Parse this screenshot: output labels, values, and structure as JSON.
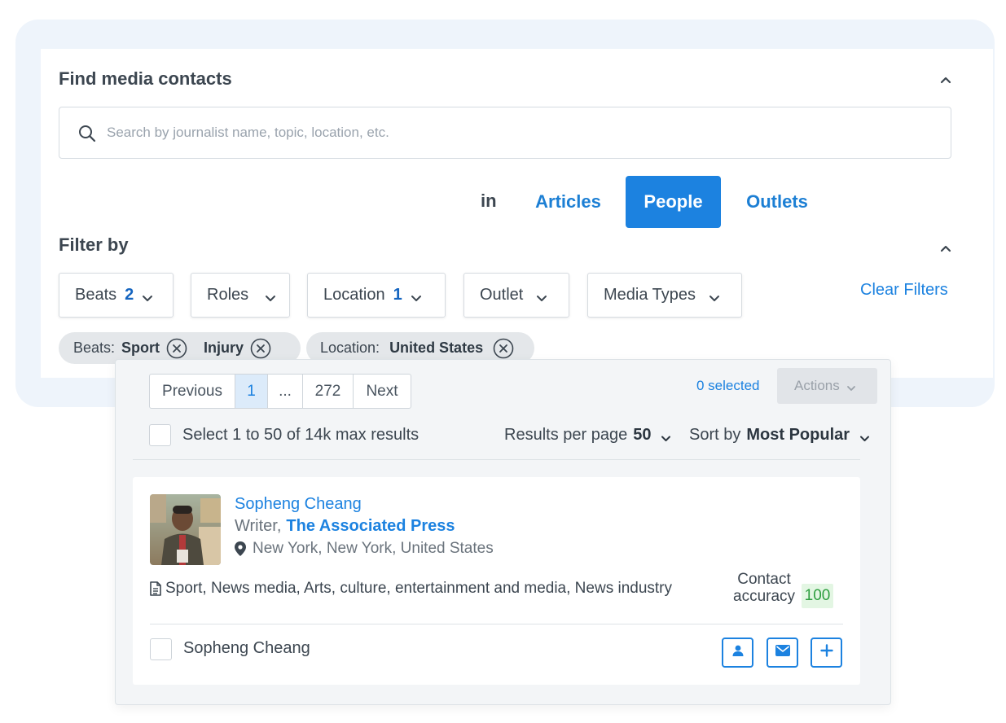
{
  "header": {
    "title": "Find media contacts",
    "collapse_icon": "chevron-up-icon"
  },
  "search": {
    "placeholder": "Search by journalist name, topic, location, etc.",
    "value": "",
    "icon": "search-icon"
  },
  "scope": {
    "in_label": "in",
    "tabs": [
      {
        "label": "Articles",
        "active": false
      },
      {
        "label": "People",
        "active": true
      },
      {
        "label": "Outlets",
        "active": false
      }
    ]
  },
  "filters": {
    "title": "Filter by",
    "buttons": [
      {
        "label": "Beats",
        "count": "2"
      },
      {
        "label": "Roles",
        "count": ""
      },
      {
        "label": "Location",
        "count": "1"
      },
      {
        "label": "Outlet",
        "count": ""
      },
      {
        "label": "Media Types",
        "count": ""
      }
    ],
    "clear_label": "Clear Filters",
    "chips": [
      {
        "key": "Beats:",
        "values": [
          "Sport",
          "Injury"
        ]
      },
      {
        "key": "Location:",
        "values": [
          "United States"
        ]
      }
    ]
  },
  "pagination": {
    "previous": "Previous",
    "current": "1",
    "ellipsis": "...",
    "last": "272",
    "next": "Next"
  },
  "selection": {
    "count_label": "0 selected",
    "actions_label": "Actions",
    "select_all_label": "Select 1 to 50 of 14k max results"
  },
  "results_per_page": {
    "label": "Results per page",
    "value": "50"
  },
  "sort": {
    "label": "Sort by",
    "value": "Most Popular"
  },
  "result": {
    "name": "Sopheng Cheang",
    "role": "Writer,",
    "outlet": "The Associated Press",
    "location": "New York, New York, United States",
    "beats": "Sport, News media, Arts, culture, entertainment and media, News industry",
    "accuracy_label_line1": "Contact",
    "accuracy_label_line2": "accuracy",
    "accuracy_value": "100",
    "checkbox_label": "Sopheng Cheang",
    "action_icons": [
      "person-icon",
      "mail-icon",
      "plus-icon"
    ]
  },
  "colors": {
    "accent": "#1c82e0",
    "accuracy_good": "#2e9e3f",
    "outer_bg": "#eef4fb"
  }
}
